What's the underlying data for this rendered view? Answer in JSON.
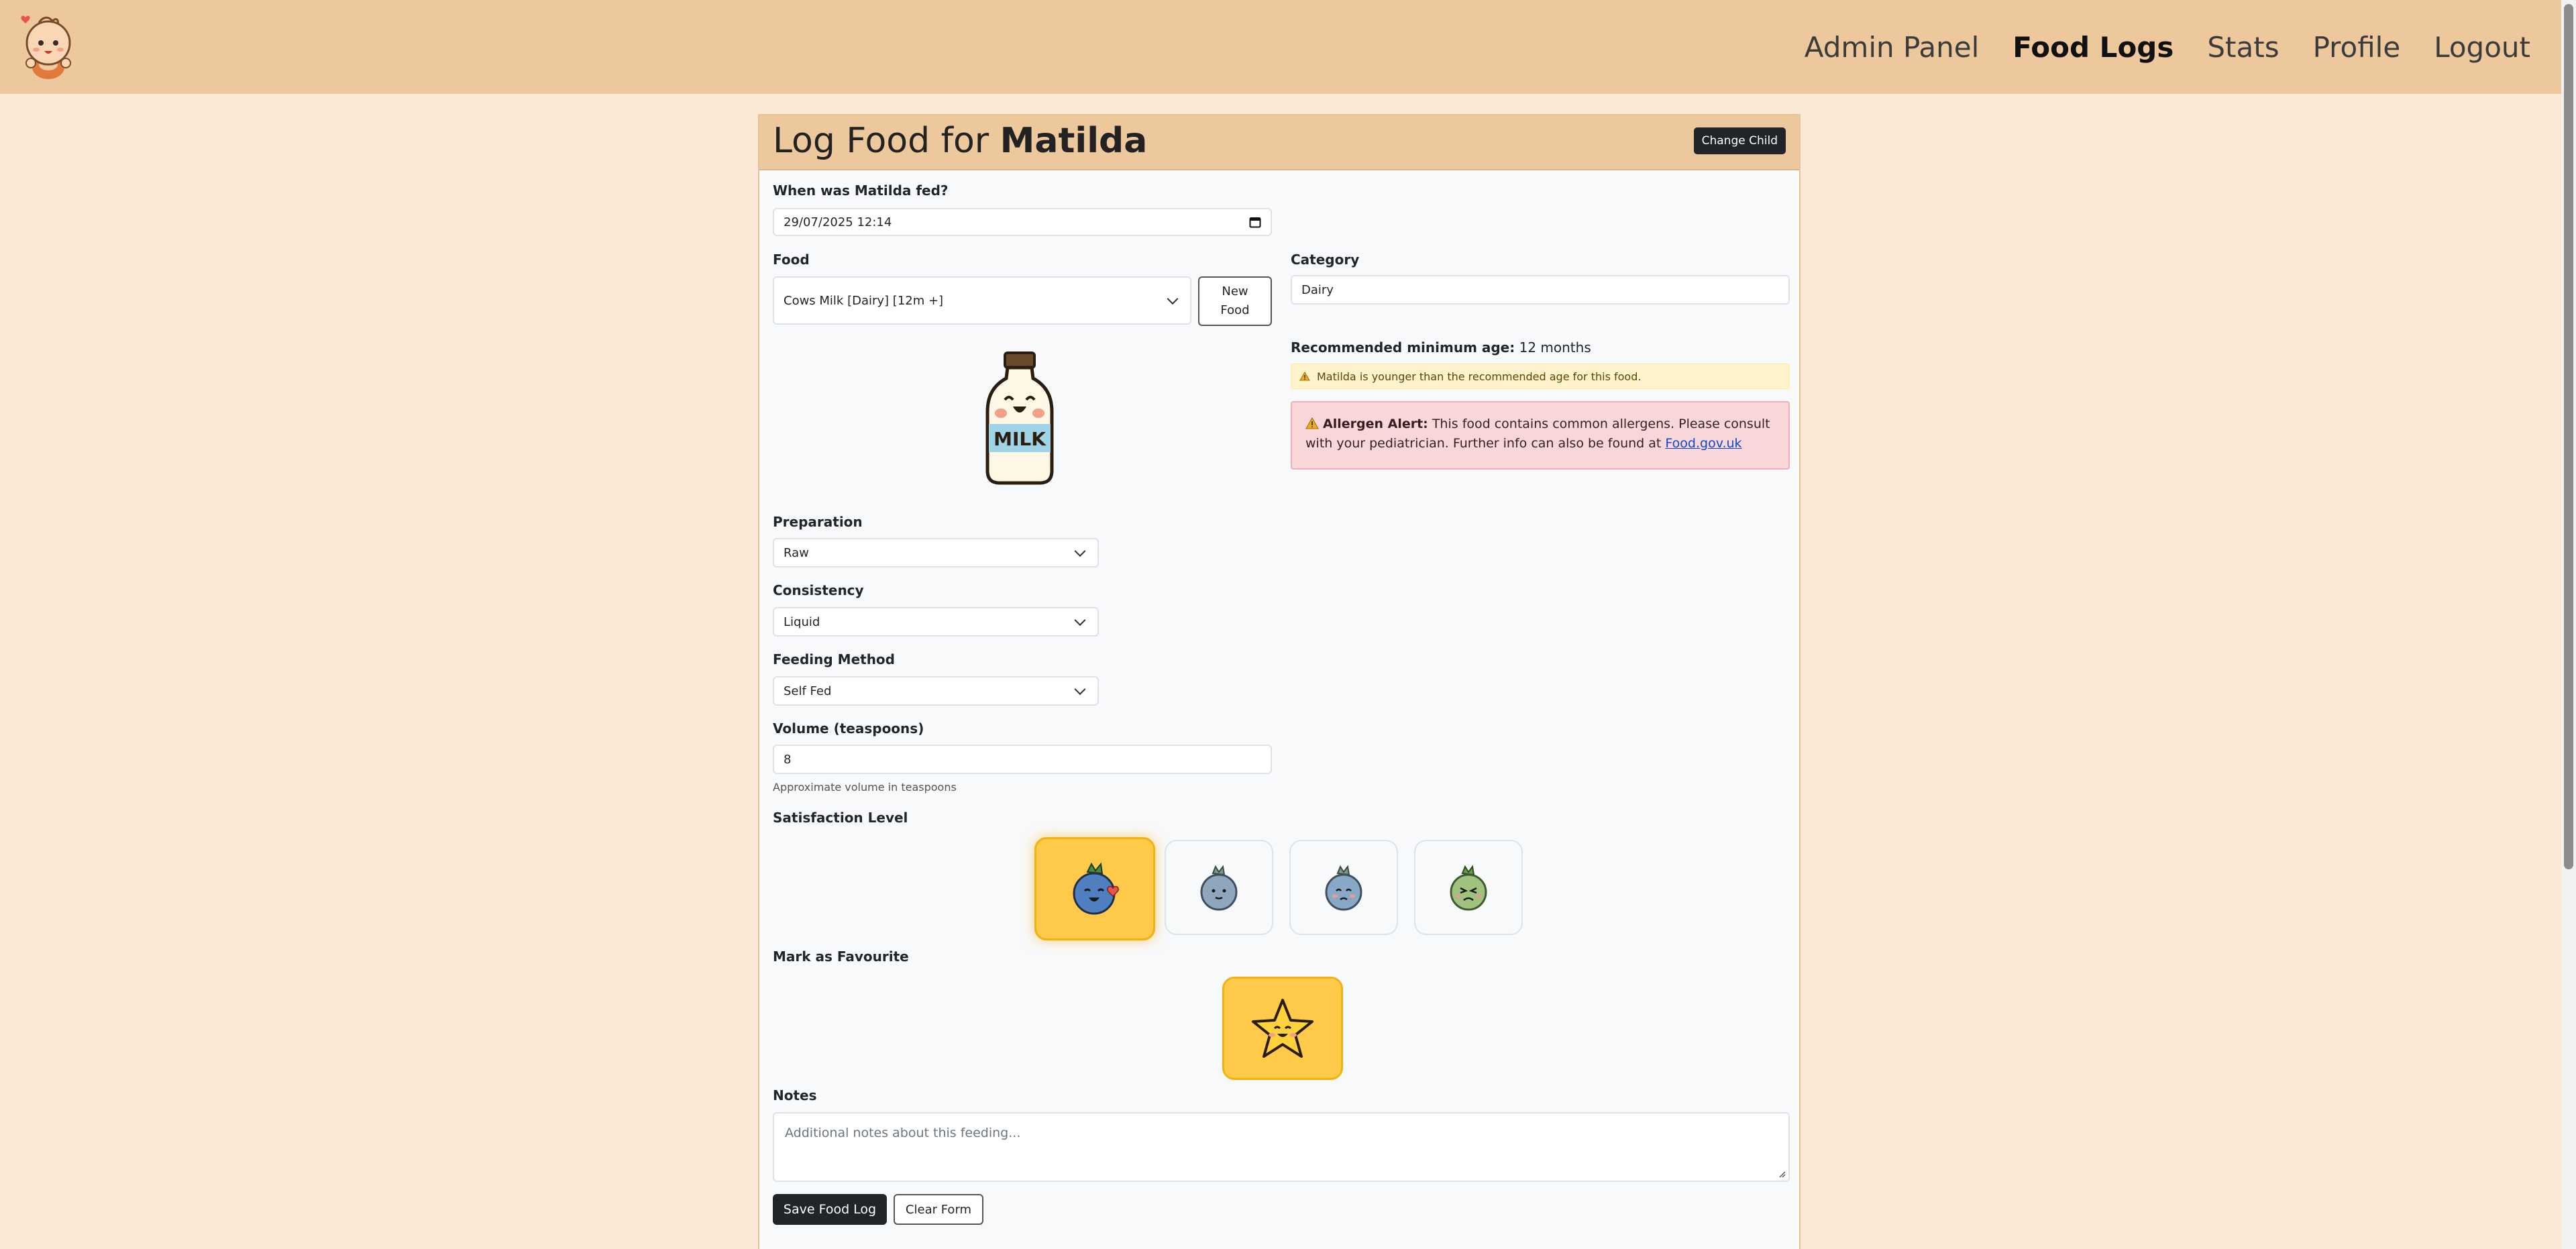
{
  "nav": {
    "links": [
      "Admin Panel",
      "Food Logs",
      "Stats",
      "Profile",
      "Logout"
    ],
    "active": "Food Logs"
  },
  "header": {
    "title_prefix": "Log Food for ",
    "child_name": "Matilda",
    "change_child_label": "Change Child"
  },
  "form": {
    "fed_time_label": "When was Matilda fed?",
    "fed_time_value": "29/07/2025 12:14",
    "food_label": "Food",
    "food_value": "Cows Milk [Dairy] [12m +]",
    "new_food_label_line1": "New",
    "new_food_label_line2": "Food",
    "food_image_icon": "milk-bottle-icon",
    "category_label": "Category",
    "category_value": "Dairy",
    "rec_age_label": "Recommended minimum age:",
    "rec_age_value": "12 months",
    "age_warning": "Matilda is younger than the recommended age for this food.",
    "allergen_title": "Allergen Alert:",
    "allergen_text_1": "This food contains common allergens. Please consult",
    "allergen_text_2": "with your pediatrician. Further info can also be found at",
    "allergen_link": "Food.gov.uk",
    "preparation_label": "Preparation",
    "preparation_value": "Raw",
    "consistency_label": "Consistency",
    "consistency_value": "Liquid",
    "feeding_method_label": "Feeding Method",
    "feeding_method_value": "Self Fed",
    "volume_label": "Volume (teaspoons)",
    "volume_value": "8",
    "volume_help": "Approximate volume in teaspoons",
    "satisfaction_label": "Satisfaction Level",
    "satisfaction_options": [
      "love-berry-icon",
      "neutral-berry-icon",
      "sad-berry-icon",
      "disgust-berry-icon"
    ],
    "satisfaction_selected": 0,
    "favourite_label": "Mark as Favourite",
    "favourite_selected": true,
    "notes_label": "Notes",
    "notes_placeholder": "Additional notes about this feeding...",
    "save_label": "Save Food Log",
    "clear_label": "Clear Form"
  },
  "colors": {
    "navbar": "#edc89d",
    "page_bg": "#fbe9d6",
    "accent_selected": "#ffc94a",
    "dark_button": "#212529",
    "alert_bg": "#f8d7da",
    "warning_bg": "#fff3cd"
  }
}
